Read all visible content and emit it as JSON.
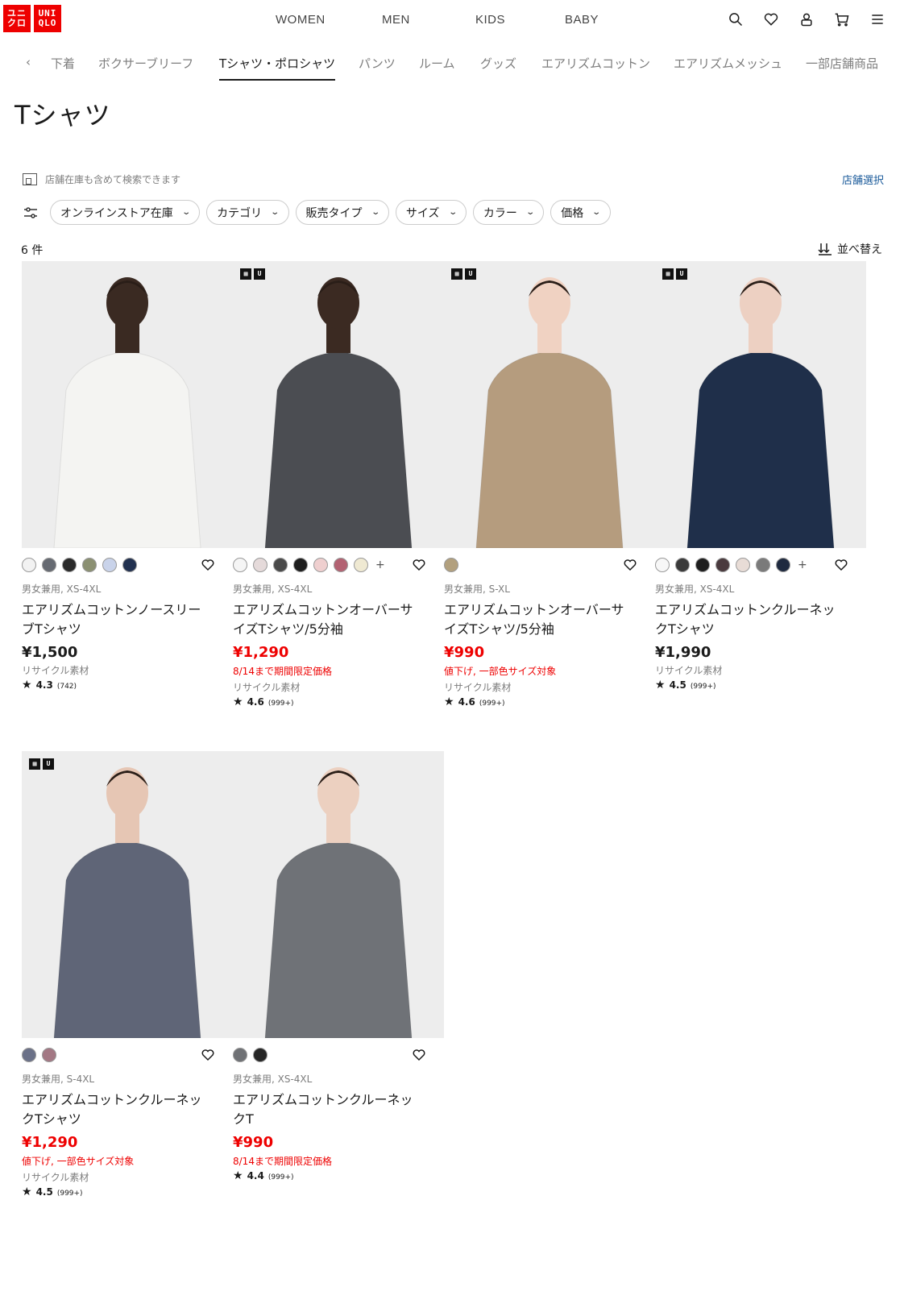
{
  "header": {
    "logo_top": "ユニ",
    "logo_bottom": "クロ",
    "logo2_top": "UNI",
    "logo2_bottom": "QLO",
    "nav": [
      "WOMEN",
      "MEN",
      "KIDS",
      "BABY"
    ]
  },
  "subnav": {
    "items": [
      "下着",
      "ボクサーブリーフ",
      "Tシャツ・ポロシャツ",
      "パンツ",
      "ルーム",
      "グッズ",
      "エアリズムコットン",
      "エアリズムメッシュ",
      "一部店舗商品"
    ],
    "active_index": 2
  },
  "page_title": "Tシャツ",
  "store": {
    "info": "店舗在庫も含めて検索できます",
    "link": "店舗選択"
  },
  "filters": [
    "オンラインストア在庫",
    "カテゴリ",
    "販売タイプ",
    "サイズ",
    "カラー",
    "価格"
  ],
  "count": "6 件",
  "sort_label": "並べ替え",
  "products": [
    {
      "badge": false,
      "swatches": [
        "#f2f2f2",
        "#666a72",
        "#2a2a2a",
        "#8b9072",
        "#c9d3ea",
        "#223150"
      ],
      "more": "",
      "meta": "男女兼用, XS-4XL",
      "name": "エアリズムコットンノースリーブTシャツ",
      "price": "¥1,500",
      "sale": false,
      "promo": "",
      "recycle": "リサイクル素材",
      "rating": "4.3",
      "reviews": "(742)",
      "shirt_color": "#f4f4f2",
      "skin": "#3a2a22"
    },
    {
      "badge": true,
      "swatches": [
        "#f5f5f5",
        "#e5dada",
        "#4a4a4a",
        "#1e1e1e",
        "#efcfcf",
        "#b36272",
        "#efe9d2"
      ],
      "more": "+",
      "meta": "男女兼用, XS-4XL",
      "name": "エアリズムコットンオーバーサイズTシャツ/5分袖",
      "price": "¥1,290",
      "sale": true,
      "promo": "8/14まで期間限定価格",
      "recycle": "リサイクル素材",
      "rating": "4.6",
      "reviews": "(999+)",
      "shirt_color": "#4b4d52",
      "skin": "#3b2a22"
    },
    {
      "badge": true,
      "swatches": [
        "#b2a07e"
      ],
      "more": "",
      "meta": "男女兼用, S-XL",
      "name": "エアリズムコットンオーバーサイズTシャツ/5分袖",
      "price": "¥990",
      "sale": true,
      "promo": "値下げ, 一部色サイズ対象",
      "recycle": "リサイクル素材",
      "rating": "4.6",
      "reviews": "(999+)",
      "shirt_color": "#b59c7e",
      "skin": "#f0d2c2"
    },
    {
      "badge": true,
      "swatches": [
        "#f7f7f7",
        "#3a3a3a",
        "#1e1e1e",
        "#4a3a3e",
        "#e8dcd6",
        "#7a7a7a",
        "#1f2a40"
      ],
      "more": "+",
      "meta": "男女兼用, XS-4XL",
      "name": "エアリズムコットンクルーネックTシャツ",
      "price": "¥1,990",
      "sale": false,
      "promo": "",
      "recycle": "リサイクル素材",
      "rating": "4.5",
      "reviews": "(999+)",
      "shirt_color": "#1f2f4a",
      "skin": "#edd0c2"
    },
    {
      "badge": true,
      "swatches": [
        "#6b7188",
        "#a37884"
      ],
      "more": "",
      "meta": "男女兼用, S-4XL",
      "name": "エアリズムコットンクルーネックTシャツ",
      "price": "¥1,290",
      "sale": true,
      "promo": "値下げ, 一部色サイズ対象",
      "recycle": "リサイクル素材",
      "rating": "4.5",
      "reviews": "(999+)",
      "shirt_color": "#5f6577",
      "skin": "#e6c6b4"
    },
    {
      "badge": false,
      "swatches": [
        "#6f7175",
        "#262626"
      ],
      "more": "",
      "meta": "男女兼用, XS-4XL",
      "name": "エアリズムコットンクルーネックT",
      "price": "¥990",
      "sale": true,
      "promo": "8/14まで期間限定価格",
      "recycle": "",
      "rating": "4.4",
      "reviews": "(999+)",
      "shirt_color": "#6f7277",
      "skin": "#ecd0c0"
    }
  ]
}
